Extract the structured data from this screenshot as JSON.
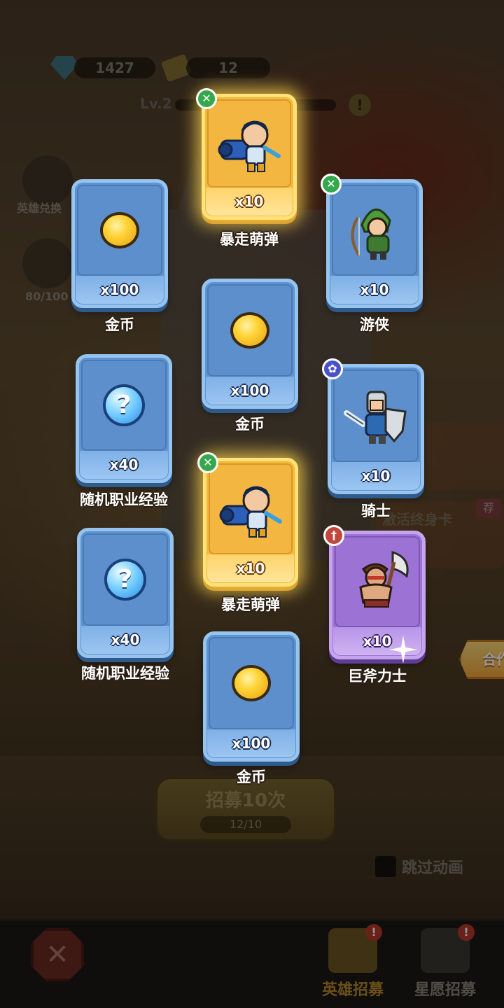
{
  "hud": {
    "gems": "1427",
    "tickets": "12",
    "level": "Lv.2"
  },
  "side": {
    "hero_exchange_label": "英雄兑换",
    "star_progress": "80/100"
  },
  "right_panels": {
    "lifetime_card_text": "激活终身卡",
    "recommend_badge": "荐",
    "cooperate_button": "合作"
  },
  "recruit": {
    "button_label": "招募10次",
    "ticket_count": "12/10",
    "skip_animation": "跳过动画"
  },
  "bottom_nav": {
    "close_icon": "crossed-swords-close-icon",
    "tabs": [
      {
        "label": "英雄招募",
        "alert": "!",
        "icon": "hero-recruit-card-icon",
        "color": "#b6892c"
      },
      {
        "label": "星愿招募",
        "alert": "!",
        "icon": "star-wish-icon",
        "color": "#8a8578"
      }
    ]
  },
  "colors": {
    "blue_card": "#5d93cf",
    "gold_card": "#f5b83b",
    "purple_card": "#9f73d6"
  },
  "rewards": [
    {
      "id": "r1",
      "name": "暴走萌弹",
      "qty": "x10",
      "rarity": "gold",
      "icon": "cannon-hero-icon",
      "class_icon": "crossed-arrows-icon"
    },
    {
      "id": "r2",
      "name": "金币",
      "qty": "x100",
      "rarity": "blue",
      "icon": "gold-coin-icon"
    },
    {
      "id": "r3",
      "name": "游侠",
      "qty": "x10",
      "rarity": "blue",
      "icon": "ranger-archer-icon",
      "class_icon": "crossed-arrows-icon"
    },
    {
      "id": "r4",
      "name": "金币",
      "qty": "x100",
      "rarity": "blue",
      "icon": "gold-coin-icon"
    },
    {
      "id": "r5",
      "name": "随机职业经验",
      "qty": "x40",
      "rarity": "blue",
      "icon": "question-orb-icon"
    },
    {
      "id": "r6",
      "name": "骑士",
      "qty": "x10",
      "rarity": "blue",
      "icon": "knight-sword-shield-icon",
      "class_icon": "paw-icon"
    },
    {
      "id": "r7",
      "name": "暴走萌弹",
      "qty": "x10",
      "rarity": "gold",
      "icon": "cannon-hero-icon",
      "class_icon": "crossed-arrows-icon"
    },
    {
      "id": "r8",
      "name": "随机职业经验",
      "qty": "x40",
      "rarity": "blue",
      "icon": "question-orb-icon"
    },
    {
      "id": "r9",
      "name": "巨斧力士",
      "qty": "x10",
      "rarity": "purple",
      "icon": "axe-warrior-icon",
      "class_icon": "sword-icon"
    },
    {
      "id": "r10",
      "name": "金币",
      "qty": "x100",
      "rarity": "blue",
      "icon": "gold-coin-icon"
    }
  ]
}
